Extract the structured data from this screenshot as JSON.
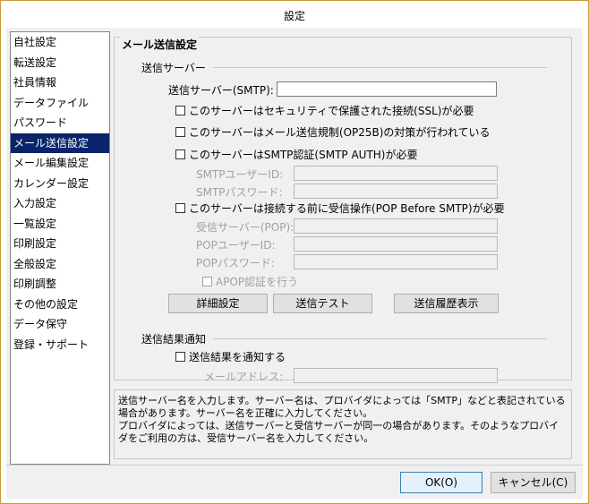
{
  "window": {
    "title": "設定"
  },
  "sidebar": {
    "items": [
      {
        "label": "自社設定"
      },
      {
        "label": "転送設定"
      },
      {
        "label": "社員情報"
      },
      {
        "label": "データファイル"
      },
      {
        "label": "パスワード"
      },
      {
        "label": "メール送信設定",
        "selected": true
      },
      {
        "label": "メール編集設定"
      },
      {
        "label": "カレンダー設定"
      },
      {
        "label": "入力設定"
      },
      {
        "label": "一覧設定"
      },
      {
        "label": "印刷設定"
      },
      {
        "label": "全般設定"
      },
      {
        "label": "印刷調整"
      },
      {
        "label": "その他の設定"
      },
      {
        "label": "データ保守"
      },
      {
        "label": "登録・サポート"
      }
    ]
  },
  "main": {
    "group_title": "メール送信設定",
    "smtp_section": {
      "title": "送信サーバー",
      "server_label": "送信サーバー(SMTP):",
      "server_value": "",
      "ssl_check": "このサーバーはセキュリティで保護された接続(SSL)が必要",
      "op25b_check": "このサーバーはメール送信規制(OP25B)の対策が行われている",
      "auth_check": "このサーバーはSMTP認証(SMTP AUTH)が必要",
      "smtp_user_label": "SMTPユーザーID:",
      "smtp_pass_label": "SMTPパスワード:",
      "pop_before_check": "このサーバーは接続する前に受信操作(POP Before SMTP)が必要",
      "pop_server_label": "受信サーバー(POP):",
      "pop_user_label": "POPユーザーID:",
      "pop_pass_label": "POPパスワード:",
      "apop_check": "APOP認証を行う",
      "buttons": {
        "detail": "詳細設定",
        "test": "送信テスト",
        "history": "送信履歴表示"
      }
    },
    "notify_section": {
      "title": "送信結果通知",
      "notify_check": "送信結果を通知する",
      "mail_label": "メールアドレス:"
    },
    "help_text": "送信サーバー名を入力します。サーバー名は、プロバイダによっては「SMTP」などと表記されている場合があります。サーバー名を正確に入力してください。\nプロバイダによっては、送信サーバーと受信サーバーが同一の場合があります。そのようなプロバイダをご利用の方は、受信サーバー名を入力してください。"
  },
  "footer": {
    "ok": "OK(O)",
    "cancel": "キャンセル(C)"
  }
}
